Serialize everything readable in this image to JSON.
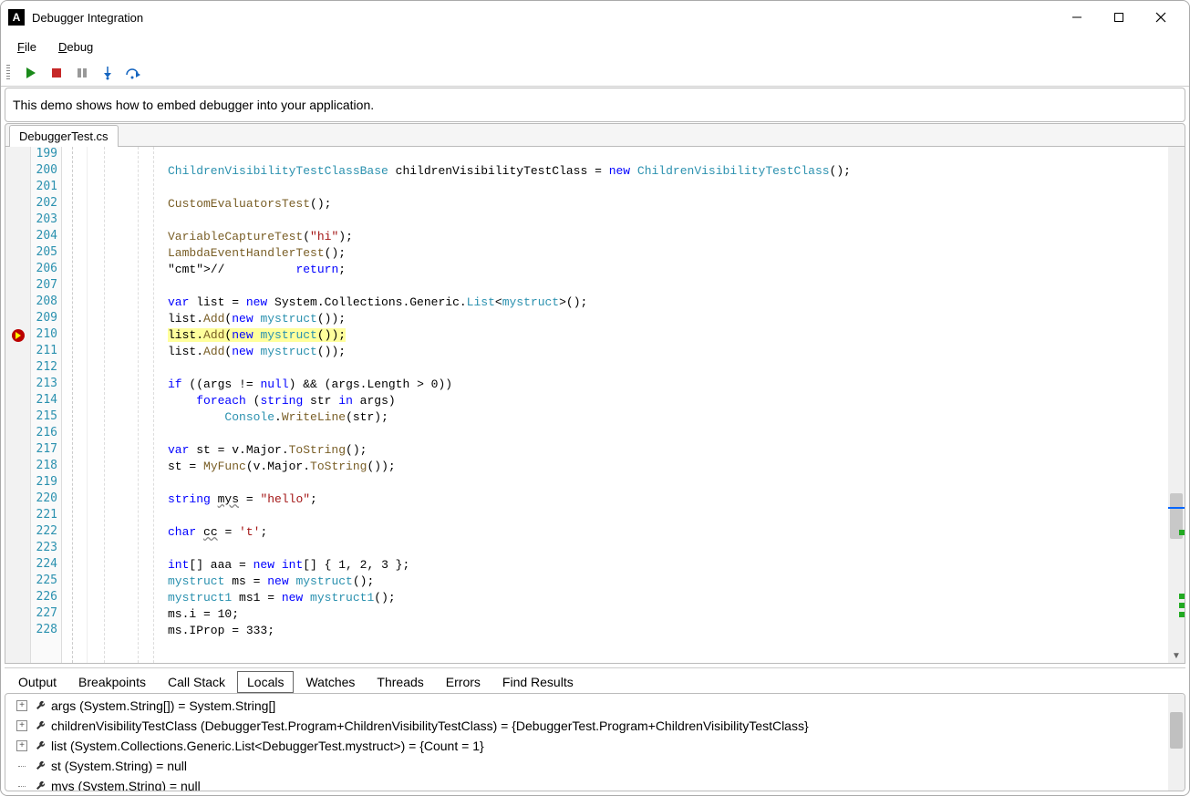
{
  "window": {
    "title": "Debugger Integration"
  },
  "menubar": {
    "file": {
      "label": "File",
      "key": "F"
    },
    "debug": {
      "label": "Debug",
      "key": "D"
    }
  },
  "toolbar": {
    "run": "Run",
    "stop": "Stop",
    "pause": "Pause",
    "step_into": "Step Into",
    "step_over": "Step Over"
  },
  "info": {
    "text": "This demo shows how to embed debugger into your application."
  },
  "file_tabs": {
    "active": "DebuggerTest.cs"
  },
  "code": {
    "first_line": 199,
    "current_line": 210,
    "lines": [
      "",
      "            ChildrenVisibilityTestClassBase childrenVisibilityTestClass = new ChildrenVisibilityTestClass();",
      "",
      "            CustomEvaluatorsTest();",
      "",
      "            VariableCaptureTest(\"hi\");",
      "            LambdaEventHandlerTest();",
      "            //          return;",
      "",
      "            var list = new System.Collections.Generic.List<mystruct>();",
      "            list.Add(new mystruct());",
      "            list.Add(new mystruct());",
      "            list.Add(new mystruct());",
      "",
      "            if ((args != null) && (args.Length > 0))",
      "                foreach (string str in args)",
      "                    Console.WriteLine(str);",
      "",
      "            var st = v.Major.ToString();",
      "            st = MyFunc(v.Major.ToString());",
      "",
      "            string mys = \"hello\";",
      "",
      "            char cc = 't';",
      "",
      "            int[] aaa = new int[] { 1, 2, 3 };",
      "            mystruct ms = new mystruct();",
      "            mystruct1 ms1 = new mystruct1();",
      "            ms.i = 10;",
      "            ms.IProp = 333;"
    ]
  },
  "bottom_tabs": {
    "items": [
      "Output",
      "Breakpoints",
      "Call Stack",
      "Locals",
      "Watches",
      "Threads",
      "Errors",
      "Find Results"
    ],
    "active": "Locals"
  },
  "locals": {
    "items": [
      {
        "expandable": true,
        "text": "args (System.String[]) = System.String[]"
      },
      {
        "expandable": true,
        "text": "childrenVisibilityTestClass (DebuggerTest.Program+ChildrenVisibilityTestClass) = {DebuggerTest.Program+ChildrenVisibilityTestClass}"
      },
      {
        "expandable": true,
        "text": "list (System.Collections.Generic.List<DebuggerTest.mystruct>) = {Count = 1}"
      },
      {
        "expandable": false,
        "text": "st (System.String) = null"
      },
      {
        "expandable": false,
        "text": "mys (System.String) = null"
      }
    ]
  }
}
